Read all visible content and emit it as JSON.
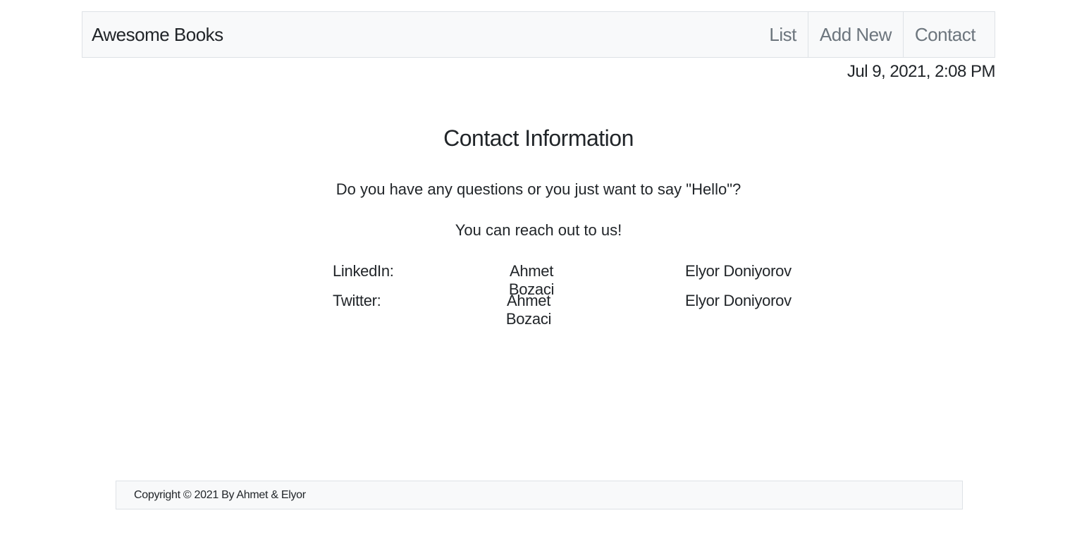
{
  "navbar": {
    "brand": "Awesome Books",
    "links": [
      "List",
      "Add New",
      "Contact"
    ]
  },
  "datetime": "Jul 9, 2021, 2:08 PM",
  "contact": {
    "title": "Contact Information",
    "question": "Do you have any questions or you just want to say \"Hello\"?",
    "reach": "You can reach out to us!",
    "rows": [
      {
        "label": "LinkedIn:",
        "person1": "Ahmet Bozaci",
        "person2": "Elyor Doniyorov"
      },
      {
        "label": "Twitter:",
        "person1": "Ahmet Bozaci",
        "person2": "Elyor Doniyorov"
      }
    ]
  },
  "footer": {
    "copyright": "Copyright © 2021 By Ahmet & Elyor"
  }
}
